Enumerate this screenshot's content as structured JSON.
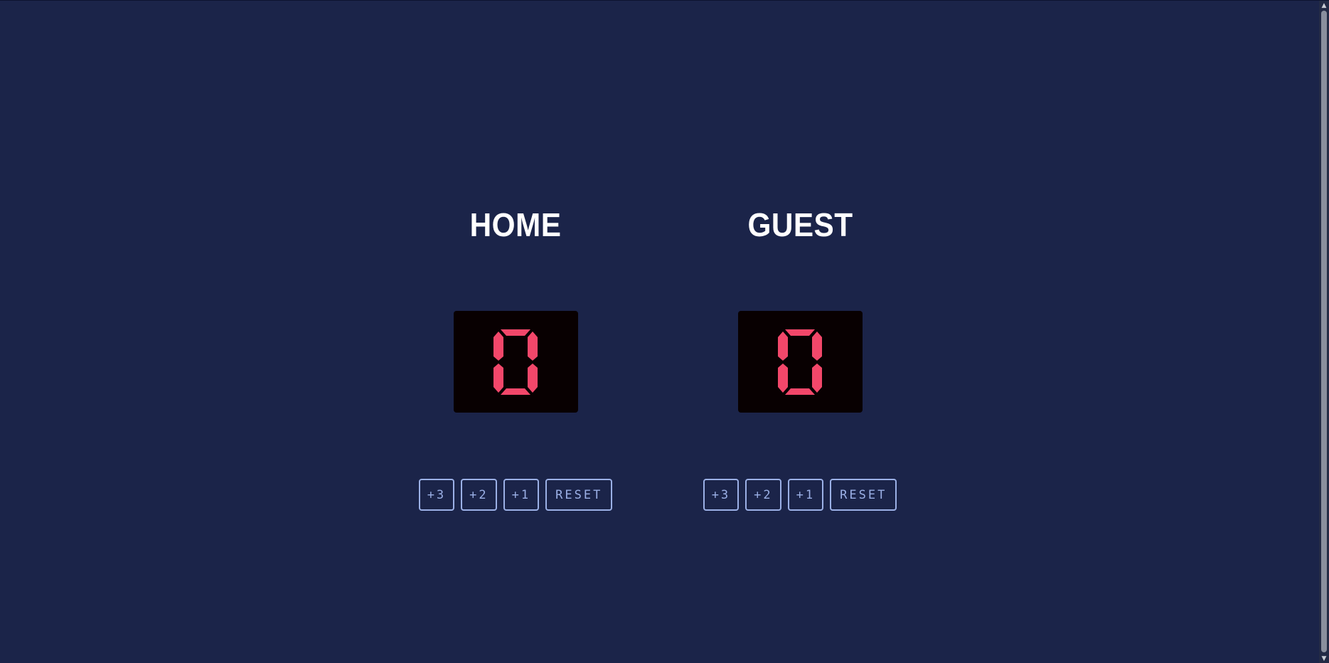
{
  "home": {
    "title": "HOME",
    "score": 0,
    "buttons": {
      "plus3": "+3",
      "plus2": "+2",
      "plus1": "+1",
      "reset": "RESET"
    }
  },
  "guest": {
    "title": "GUEST",
    "score": 0,
    "buttons": {
      "plus3": "+3",
      "plus2": "+2",
      "plus1": "+1",
      "reset": "RESET"
    }
  },
  "colors": {
    "background": "#1b2449",
    "score_panel": "#080001",
    "score_digit": "#f2476a",
    "button_accent": "#9bb0e6",
    "title_text": "#ffffff"
  },
  "icons": {
    "scroll_up": "chevron-up-icon",
    "scroll_down": "chevron-down-icon"
  }
}
